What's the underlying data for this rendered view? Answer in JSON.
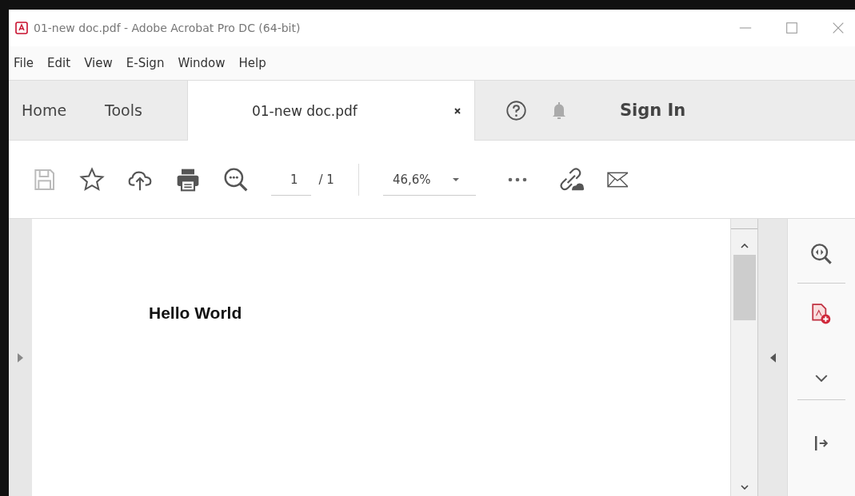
{
  "window": {
    "title": "01-new doc.pdf - Adobe Acrobat Pro DC (64-bit)"
  },
  "menu": [
    "File",
    "Edit",
    "View",
    "E-Sign",
    "Window",
    "Help"
  ],
  "tabs": [
    {
      "label": "Home",
      "selected": false,
      "kind": "nav"
    },
    {
      "label": "Tools",
      "selected": false,
      "kind": "nav"
    },
    {
      "label": "01-new doc.pdf",
      "selected": true,
      "kind": "document"
    }
  ],
  "sign_in": "Sign In",
  "toolbar": {
    "page_number": "1",
    "page_total": "/ 1",
    "zoom": "46,6%"
  },
  "document": {
    "text": "Hello World"
  }
}
